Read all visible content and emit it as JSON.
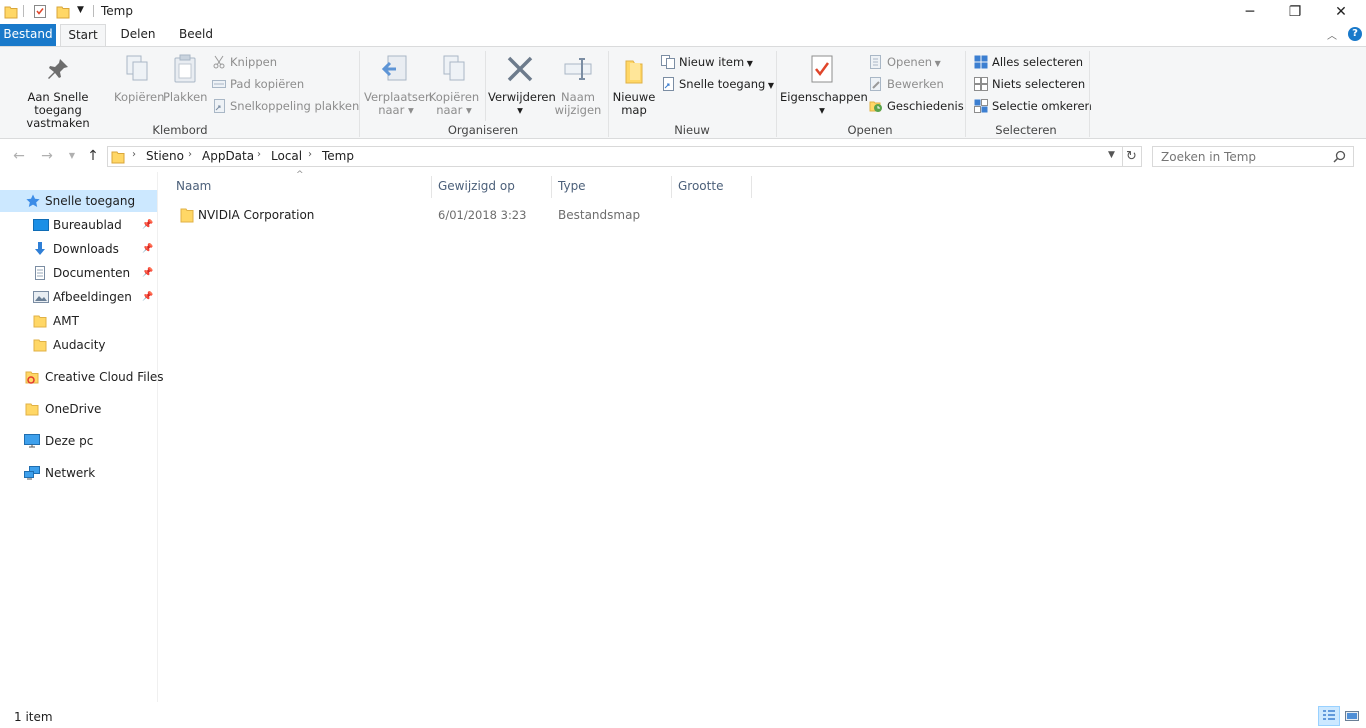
{
  "window": {
    "title": "Temp",
    "controls": {
      "minimize": "─",
      "maximize": "❐",
      "close": "✕"
    }
  },
  "ribbon_tabs": [
    {
      "label": "Bestand"
    },
    {
      "label": "Start"
    },
    {
      "label": "Delen"
    },
    {
      "label": "Beeld"
    }
  ],
  "ribbon": {
    "klembord": {
      "label": "Klembord",
      "pin_quick_access": "Aan Snelle toegang vastmaken",
      "copy": "Kopiëren",
      "paste": "Plakken",
      "cut": "Knippen",
      "copy_path": "Pad kopiëren",
      "paste_shortcut": "Snelkoppeling plakken"
    },
    "organiseren": {
      "label": "Organiseren",
      "move_to": "Verplaatsen naar",
      "copy_to": "Kopiëren naar",
      "delete": "Verwijderen",
      "rename": "Naam wijzigen"
    },
    "nieuw": {
      "label": "Nieuw",
      "new_folder": "Nieuwe map",
      "new_item": "Nieuw item",
      "easy_access": "Snelle toegang"
    },
    "openen": {
      "label": "Openen",
      "properties": "Eigenschappen",
      "open": "Openen",
      "edit": "Bewerken",
      "history": "Geschiedenis"
    },
    "selecteren": {
      "label": "Selecteren",
      "select_all": "Alles selecteren",
      "select_none": "Niets selecteren",
      "invert": "Selectie omkeren"
    }
  },
  "address": {
    "crumbs": [
      "Stieno",
      "AppData",
      "Local",
      "Temp"
    ],
    "search_placeholder": "Zoeken in Temp"
  },
  "nav_pane": {
    "quick_access": "Snelle toegang",
    "pinned": [
      {
        "label": "Bureaublad",
        "icon": "desktop-icon"
      },
      {
        "label": "Downloads",
        "icon": "download-icon"
      },
      {
        "label": "Documenten",
        "icon": "document-icon"
      },
      {
        "label": "Afbeeldingen",
        "icon": "picture-icon"
      }
    ],
    "recent": [
      {
        "label": "AMT",
        "icon": "folder-icon"
      },
      {
        "label": "Audacity",
        "icon": "folder-icon"
      }
    ],
    "roots": [
      {
        "label": "Creative Cloud Files",
        "icon": "creative-cloud-icon"
      },
      {
        "label": "OneDrive",
        "icon": "folder-icon"
      },
      {
        "label": "Deze pc",
        "icon": "computer-icon"
      },
      {
        "label": "Netwerk",
        "icon": "network-icon"
      }
    ]
  },
  "columns": [
    "Naam",
    "Gewijzigd op",
    "Type",
    "Grootte"
  ],
  "files": [
    {
      "name": "NVIDIA Corporation",
      "modified": "6/01/2018 3:23",
      "type": "Bestandsmap",
      "size": ""
    }
  ],
  "status": {
    "count": "1 item"
  },
  "colors": {
    "file_tab": "#1979ca",
    "selection": "#cce8ff",
    "folder": "#ffd766"
  }
}
